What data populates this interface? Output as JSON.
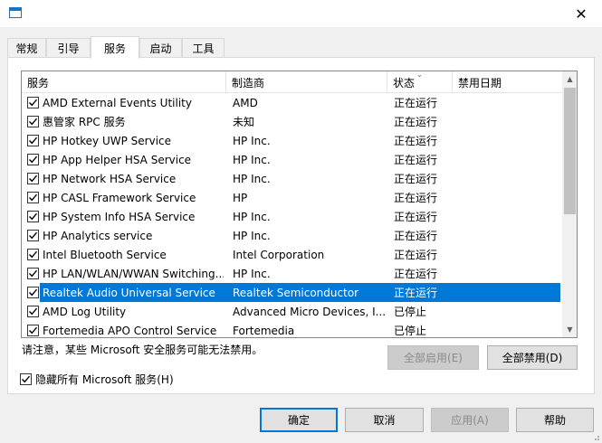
{
  "window": {
    "close_glyph": "✕"
  },
  "tabs": [
    {
      "label": "常规"
    },
    {
      "label": "引导"
    },
    {
      "label": "服务",
      "active": true
    },
    {
      "label": "启动"
    },
    {
      "label": "工具"
    }
  ],
  "columns": {
    "service": "服务",
    "manufacturer": "制造商",
    "status": "状态",
    "disabled_date": "禁用日期"
  },
  "services": [
    {
      "name": "AMD External Events Utility",
      "manufacturer": "AMD",
      "status": "正在运行",
      "checked": true
    },
    {
      "name": "惠管家 RPC 服务",
      "manufacturer": "未知",
      "status": "正在运行",
      "checked": true
    },
    {
      "name": "HP Hotkey UWP Service",
      "manufacturer": "HP Inc.",
      "status": "正在运行",
      "checked": true
    },
    {
      "name": "HP App Helper HSA Service",
      "manufacturer": "HP Inc.",
      "status": "正在运行",
      "checked": true
    },
    {
      "name": "HP Network HSA Service",
      "manufacturer": "HP Inc.",
      "status": "正在运行",
      "checked": true
    },
    {
      "name": "HP CASL Framework Service",
      "manufacturer": "HP",
      "status": "正在运行",
      "checked": true
    },
    {
      "name": "HP System Info HSA Service",
      "manufacturer": "HP Inc.",
      "status": "正在运行",
      "checked": true
    },
    {
      "name": "HP Analytics service",
      "manufacturer": "HP Inc.",
      "status": "正在运行",
      "checked": true
    },
    {
      "name": "Intel Bluetooth Service",
      "manufacturer": "Intel Corporation",
      "status": "正在运行",
      "checked": true
    },
    {
      "name": "HP LAN/WLAN/WWAN Switching...",
      "manufacturer": "HP Inc.",
      "status": "正在运行",
      "checked": true
    },
    {
      "name": "Realtek Audio Universal Service",
      "manufacturer": "Realtek Semiconductor",
      "status": "正在运行",
      "checked": true,
      "selected": true
    },
    {
      "name": "AMD Log Utility",
      "manufacturer": "Advanced Micro Devices, I...",
      "status": "已停止",
      "checked": true
    },
    {
      "name": "Fortemedia APO Control Service",
      "manufacturer": "Fortemedia",
      "status": "已停止",
      "checked": true
    }
  ],
  "notice": "请注意，某些 Microsoft 安全服务可能无法禁用。",
  "buttons": {
    "enable_all": "全部启用(E)",
    "disable_all": "全部禁用(D)",
    "ok": "确定",
    "cancel": "取消",
    "apply": "应用(A)",
    "help": "帮助"
  },
  "hide_ms": {
    "label": "隐藏所有 Microsoft 服务(H)",
    "checked": true
  },
  "colors": {
    "selection": "#0078d7",
    "accent": "#0078d7"
  }
}
